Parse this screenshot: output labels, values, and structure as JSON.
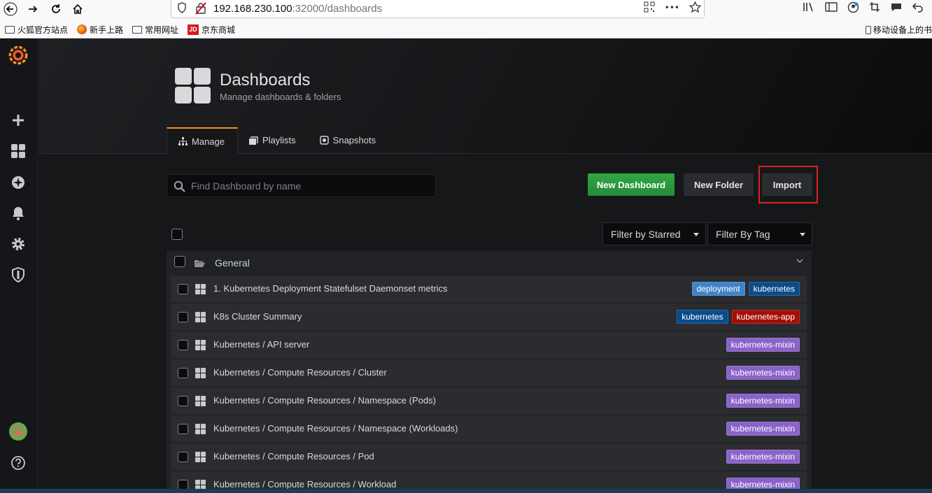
{
  "browser": {
    "url_host": "192.168.230.100",
    "url_rest": ":32000/dashboards",
    "bookmarks": [
      "火狐官方站点",
      "新手上路",
      "常用网址",
      "京东商城"
    ],
    "jd_badge": "JD",
    "mobile_bookmarks": "移动设备上的书",
    "more_glyph": "•••"
  },
  "header": {
    "title": "Dashboards",
    "subtitle": "Manage dashboards & folders"
  },
  "tabs": [
    {
      "label": "Manage"
    },
    {
      "label": "Playlists"
    },
    {
      "label": "Snapshots"
    }
  ],
  "toolbar": {
    "search_placeholder": "Find Dashboard by name",
    "new_dashboard": "New Dashboard",
    "new_folder": "New Folder",
    "import": "Import"
  },
  "filters": {
    "starred": "Filter by Starred",
    "tag": "Filter By Tag"
  },
  "folder": {
    "name": "General"
  },
  "dashboards": [
    {
      "title": "1. Kubernetes Deployment Statefulset Daemonset metrics",
      "tags": [
        "deployment",
        "kubernetes"
      ]
    },
    {
      "title": "K8s Cluster Summary",
      "tags": [
        "kubernetes",
        "kubernetes-app"
      ]
    },
    {
      "title": "Kubernetes / API server",
      "tags": [
        "kubernetes-mixin"
      ]
    },
    {
      "title": "Kubernetes / Compute Resources / Cluster",
      "tags": [
        "kubernetes-mixin"
      ]
    },
    {
      "title": "Kubernetes / Compute Resources / Namespace (Pods)",
      "tags": [
        "kubernetes-mixin"
      ]
    },
    {
      "title": "Kubernetes / Compute Resources / Namespace (Workloads)",
      "tags": [
        "kubernetes-mixin"
      ]
    },
    {
      "title": "Kubernetes / Compute Resources / Pod",
      "tags": [
        "kubernetes-mixin"
      ]
    },
    {
      "title": "Kubernetes / Compute Resources / Workload",
      "tags": [
        "kubernetes-mixin"
      ]
    }
  ],
  "tag_colors": {
    "deployment": "#3f83c9",
    "kubernetes": "#0a4c8a",
    "kubernetes-app": "#a30f06",
    "kubernetes-mixin": "#8a63c9"
  },
  "colors": {
    "accent": "#f58f24",
    "primary_button": "#2ea043",
    "highlight": "#e02020"
  }
}
